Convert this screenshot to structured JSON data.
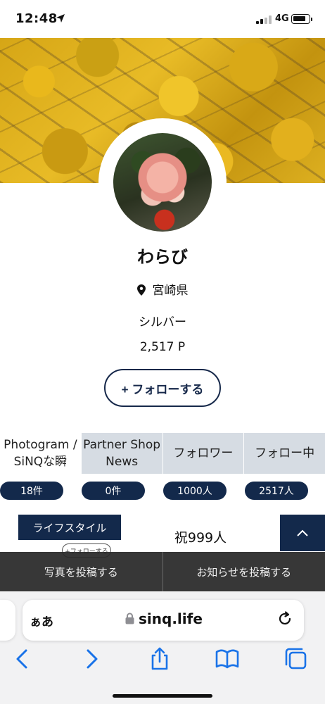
{
  "status_bar": {
    "time": "12:48",
    "network": "4G"
  },
  "profile": {
    "name": "わらび",
    "prefecture": "宮崎県",
    "rank": "シルバー",
    "points": "2,517 P",
    "follow_label": "+ フォローする"
  },
  "tabs": [
    {
      "label": "Photogram / SiNQな瞬",
      "active": true
    },
    {
      "label": "Partner Shop News",
      "active": false
    },
    {
      "label": "フォロワー",
      "active": false
    },
    {
      "label": "フォロー中",
      "active": false
    }
  ],
  "counts": [
    "18件",
    "0件",
    "1000人",
    "2517人"
  ],
  "post": {
    "category": "ライフスタイル",
    "title": "祝999人",
    "mini_follow": "+フォローする"
  },
  "post_bar": {
    "photo_label": "写真を投稿する",
    "news_label": "お知らせを投稿する"
  },
  "browser": {
    "text_size_label": "ぁあ",
    "url": "sinq.life"
  },
  "colors": {
    "navy": "#13294b",
    "tab_inactive": "#d6dce3",
    "safari_blue": "#1a73e8"
  }
}
